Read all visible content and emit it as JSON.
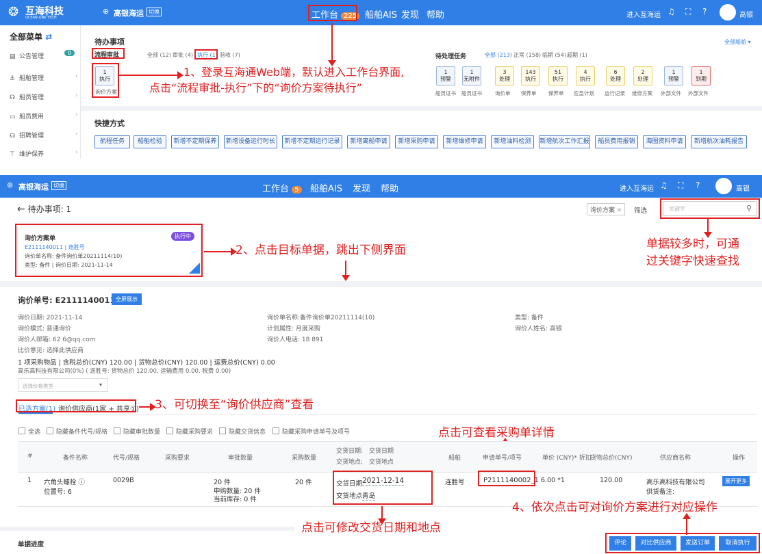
{
  "top": {
    "logo_text": "互海科技",
    "logo_sub": "OCEAN LINK TECH",
    "company": "高银海运",
    "company_badge": "切换",
    "nav": [
      {
        "label": "工作台",
        "badge": "225"
      },
      {
        "label": "船舶AIS"
      },
      {
        "label": "发现"
      },
      {
        "label": "帮助"
      }
    ],
    "enter_link": "进入互海运",
    "user": "高银"
  },
  "sidebar": {
    "title": "全部菜单",
    "items": [
      {
        "icon": "announcement-icon",
        "label": "公告管理",
        "badge": "0"
      },
      {
        "icon": "anchor-icon",
        "label": "船舶管理"
      },
      {
        "icon": "crew-icon",
        "label": "船员管理"
      },
      {
        "icon": "wallet-icon",
        "label": "船员费用"
      },
      {
        "icon": "recruit-icon",
        "label": "招聘管理"
      },
      {
        "icon": "wrench-icon",
        "label": "维护保养"
      }
    ]
  },
  "todo": {
    "title": "待办事项",
    "all_ships": "全部船舶 ▾",
    "flow_label": "流程审批",
    "filters": [
      "全部 (12)",
      "审批 (4)",
      "执行 (1)",
      "验收 (7)"
    ],
    "tile": {
      "count": "1",
      "label": "执行"
    },
    "tile_caption": "询价方案",
    "pending_title": "待处理任务",
    "pending_filters": [
      "全部 (213)",
      "正常 (158)",
      "临期 (54)",
      "超期 (1)"
    ],
    "pending_tiles": [
      {
        "count": "1",
        "label": "预警",
        "caption": "船员证书"
      },
      {
        "count": "1",
        "label": "无附件",
        "caption": "船员证书"
      },
      {
        "count": "3",
        "label": "处理",
        "caption": "询价单"
      },
      {
        "count": "143",
        "label": "执行",
        "caption": "保养单"
      },
      {
        "count": "51",
        "label": "执行",
        "caption": "保养单"
      },
      {
        "count": "4",
        "label": "执行",
        "caption": "应急计划"
      },
      {
        "count": "6",
        "label": "处理",
        "caption": "运行记录"
      },
      {
        "count": "2",
        "label": "处理",
        "caption": "维修方案"
      },
      {
        "count": "1",
        "label": "预警",
        "caption": "外部文件"
      },
      {
        "count": "1",
        "label": "到期",
        "caption": "外部文件"
      }
    ]
  },
  "quick": {
    "title": "快捷方式",
    "buttons": [
      "航程任务",
      "船舶检验",
      "新增不定期保养",
      "新增设备运行时长",
      "新增不定期运行记录",
      "新增离船申请",
      "新增采购申请",
      "新增维修申请",
      "新增油料检测",
      "新增航次工作汇报",
      "船员费用报销",
      "海图资料申请",
      "新增航次油耗报告"
    ]
  },
  "panel2": {
    "back_title": "待办事项: 1",
    "filter_tag": "询价方案",
    "filter_label": "筛选",
    "search_placeholder": "关键字",
    "card": {
      "title": "询价方案单",
      "status": "执行中",
      "code": "E2111140011 | 连胜号",
      "name_line": "询价单名称: 备件询价单20211114(10)",
      "type_line": "类型: 备件 | 询价日期: 2021-11-14"
    }
  },
  "detail": {
    "title": "询价单号: E2111140011",
    "fullscreen": "全屏展示",
    "fields": [
      "询价日期: 2021-11-14",
      "询价单名称:备件询价单20211114(10)",
      "类型: 备件",
      "询价模式: 普通询价",
      "计划属性: 月度采购",
      "询价人姓名: 高银",
      "询价人邮箱: 62              6@qq.com",
      "询价人电话: 18              891",
      "比价意见: 选择此供应商"
    ],
    "summary": "1 项采购物品  |  含税总价(CNY) 120.00  |  货物总价(CNY) 120.00  |  运费总价(CNY) 0.00",
    "summary2": "高乐高科技有限公司(0%) ( 连胜号: 货物总价 120.00, 运输费用 0.00, 税费 0.00)",
    "price_type_placeholder": "选择价格类型",
    "tab_selected": "已选方案(1)",
    "tab_suppliers": "询价供应商(1家 + 共享①)",
    "checkboxes": [
      "全选",
      "隐藏备件代号/规格",
      "隐藏审批数量",
      "隐藏采购要求",
      "隐藏交货信息",
      "隐藏采购申请单号及项号"
    ],
    "columns": [
      "#",
      "备件名称",
      "代号/规格",
      "采购要求",
      "审批数量",
      "采购数量",
      "交货日期:　交货日期",
      "交货地点:　交货地点",
      "船舶",
      "申请单号/项号",
      "单价 (CNY)* 折扣",
      "货物总价(CNY)",
      "供应商名称",
      "操作"
    ],
    "row": {
      "index": "1",
      "name": "六角头螺栓 ⓘ",
      "position": "位置号: 6",
      "code": "0029B",
      "approved": "20 件",
      "apply_qty": "申购数量: 20 件",
      "stock": "当前库存: 0 件",
      "purchase_qty": "20 件",
      "delivery_date_label": "交货日期:",
      "delivery_date": "2021-12-14",
      "delivery_place_label": "交货地点:",
      "delivery_place": "青岛",
      "ship": "连胜号",
      "apply_no": "P2111140002_1",
      "unit_price": "6.00 *1",
      "total": "120.00",
      "supplier": "高乐高科技有限公司",
      "supplier_note": "供货备注:",
      "expand": "展开更多"
    },
    "progress_title": "单据进度",
    "actions": [
      "评论",
      "对比供应商",
      "发送订单",
      "取消执行"
    ]
  },
  "annotations": {
    "a1_line1": "1、登录互海通Web端，默认进入工作台界面,",
    "a1_line2": "点击“流程审批-执行”下的“询价方案待执行”",
    "a2": "2、点击目标单据，跳出下侧界面",
    "a_search1": "单据较多时，可通",
    "a_search2": "过关键字快速查找",
    "a3": "3、可切换至“询价供应商”查看",
    "a_purchase": "点击可查看采购单详情",
    "a4": "4、依次点击可对询价方案进行对应操作",
    "a_delivery": "点击可修改交货日期和地点"
  }
}
